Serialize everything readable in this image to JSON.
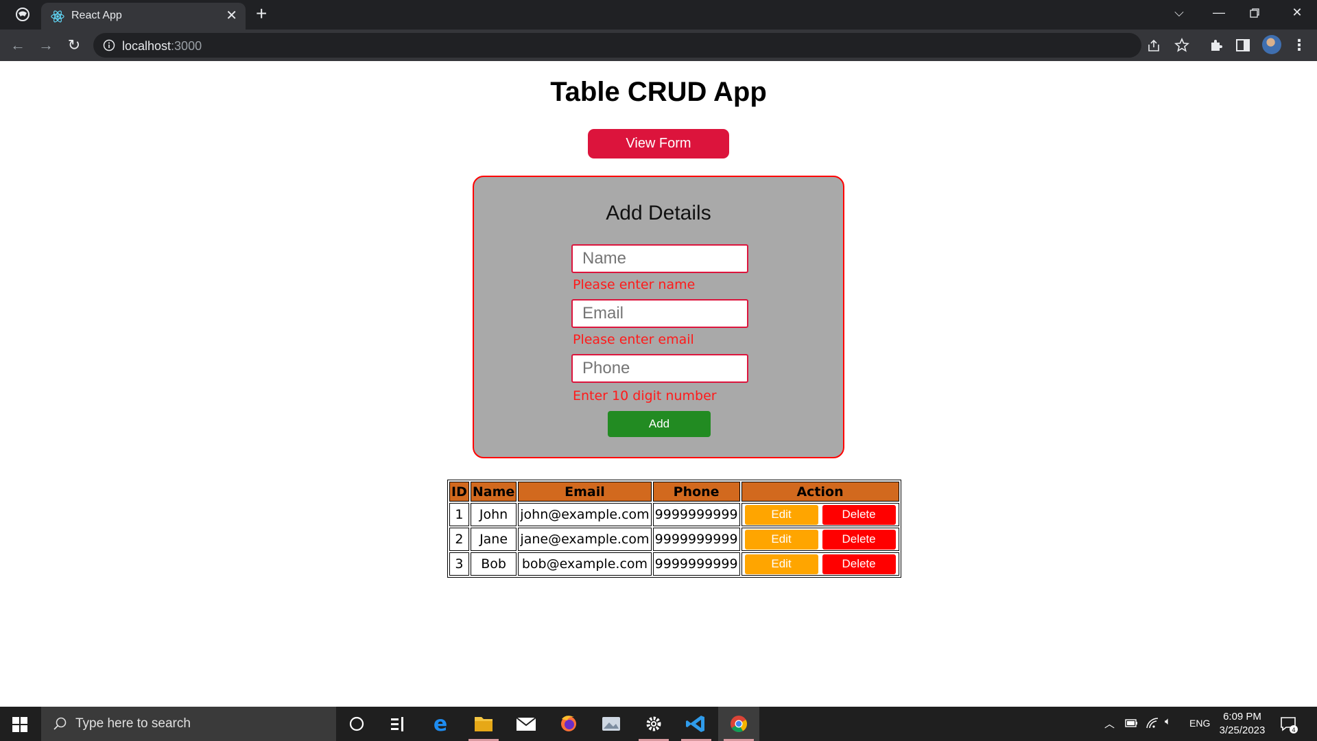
{
  "browser": {
    "tab_title": "React App",
    "url_host": "localhost",
    "url_port": ":3000"
  },
  "page": {
    "title": "Table CRUD App",
    "view_form_button": "View Form"
  },
  "form": {
    "heading": "Add Details",
    "name_placeholder": "Name",
    "name_error": "Please enter name",
    "email_placeholder": "Email",
    "email_error": "Please enter email",
    "phone_placeholder": "Phone",
    "phone_error": "Enter 10 digit number",
    "add_button": "Add"
  },
  "table": {
    "headers": [
      "ID",
      "Name",
      "Email",
      "Phone",
      "Action"
    ],
    "rows": [
      {
        "id": "1",
        "name": "John",
        "email": "john@example.com",
        "phone": "9999999999"
      },
      {
        "id": "2",
        "name": "Jane",
        "email": "jane@example.com",
        "phone": "9999999999"
      },
      {
        "id": "3",
        "name": "Bob",
        "email": "bob@example.com",
        "phone": "9999999999"
      }
    ],
    "edit_label": "Edit",
    "delete_label": "Delete"
  },
  "taskbar": {
    "search_placeholder": "Type here to search",
    "language": "ENG",
    "time": "6:09 PM",
    "date": "3/25/2023",
    "notification_count": "4"
  },
  "colors": {
    "view_form_button": "#dc143c",
    "form_card": "#a9a9a9",
    "error_text": "#ff1a1a",
    "add_button": "#228b22",
    "table_header": "#d2691e",
    "edit_button": "#ffa500",
    "delete_button": "#ff0000"
  }
}
